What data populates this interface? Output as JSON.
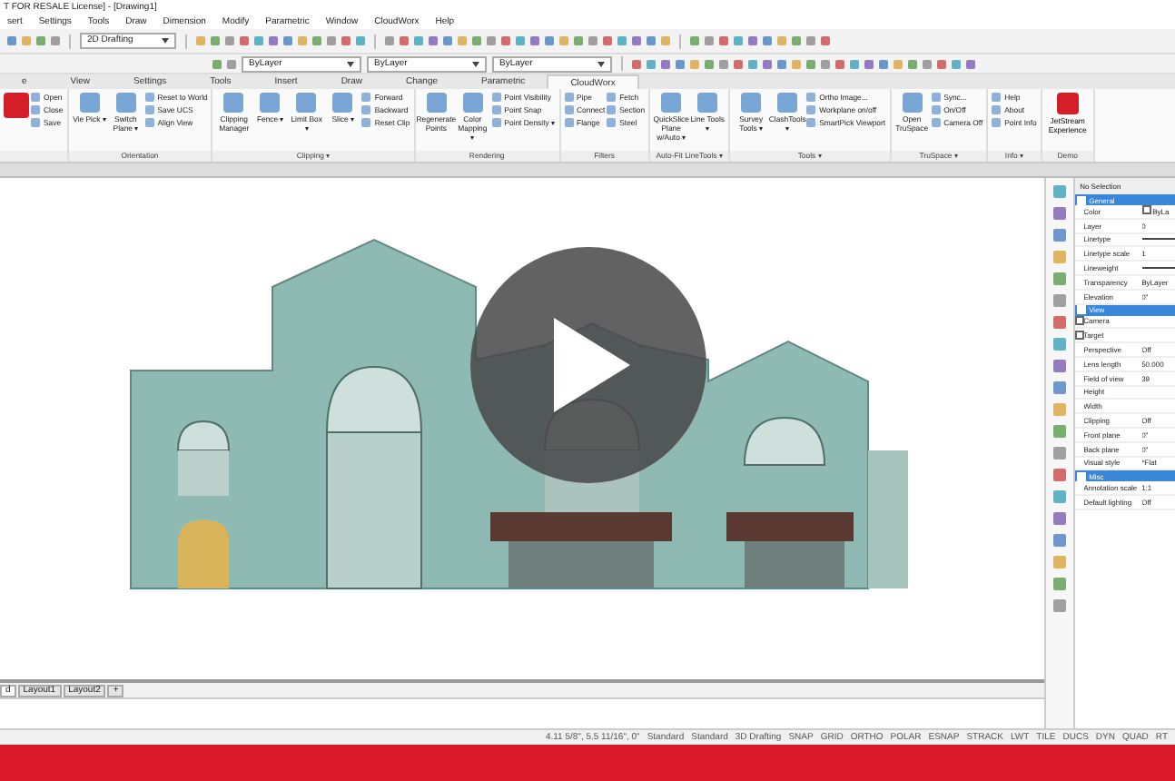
{
  "window": {
    "title": "T FOR RESALE License] - [Drawing1]"
  },
  "menu": [
    "sert",
    "Settings",
    "Tools",
    "Draw",
    "Dimension",
    "Modify",
    "Parametric",
    "Window",
    "CloudWorx",
    "Help"
  ],
  "toolbar": {
    "workspace": "2D Drafting",
    "layer_fields": [
      "ByLayer",
      "ByLayer",
      "ByLayer"
    ]
  },
  "ribbon_tabs": [
    {
      "label": "e",
      "selected": false
    },
    {
      "label": "View",
      "selected": false
    },
    {
      "label": "Settings",
      "selected": false
    },
    {
      "label": "Tools",
      "selected": false
    },
    {
      "label": "Insert",
      "selected": false
    },
    {
      "label": "Draw",
      "selected": false
    },
    {
      "label": "Change",
      "selected": false
    },
    {
      "label": "Parametric",
      "selected": false
    },
    {
      "label": "CloudWorx",
      "selected": true
    }
  ],
  "ribbon_groups": [
    {
      "buttons": [
        {
          "kind": "big"
        },
        {
          "kind": "small",
          "label": "Open"
        },
        {
          "kind": "small",
          "label": "Close"
        },
        {
          "kind": "small",
          "label": "Save"
        }
      ]
    },
    {
      "label": "Orientation",
      "buttons": [
        {
          "kind": "big",
          "label": "Vie Pick ▾"
        },
        {
          "kind": "big",
          "label": "Switch Plane ▾"
        },
        {
          "kind": "small",
          "label": "Reset to World"
        },
        {
          "kind": "small",
          "label": "Save UCS"
        },
        {
          "kind": "small",
          "label": "Align View"
        }
      ]
    },
    {
      "label": "Clipping ▾",
      "buttons": [
        {
          "kind": "big",
          "label": "Clipping Manager"
        },
        {
          "kind": "big",
          "label": "Fence ▾"
        },
        {
          "kind": "big",
          "label": "Limit Box ▾"
        },
        {
          "kind": "big",
          "label": "Slice ▾"
        },
        {
          "kind": "small",
          "label": "Forward"
        },
        {
          "kind": "small",
          "label": "Backward"
        },
        {
          "kind": "small",
          "label": "Reset Clip"
        }
      ]
    },
    {
      "label": "Rendering",
      "buttons": [
        {
          "kind": "big",
          "label": "Regenerate Points"
        },
        {
          "kind": "big",
          "label": "Color Mapping ▾"
        },
        {
          "kind": "small",
          "label": "Point Visibility"
        },
        {
          "kind": "small",
          "label": "Point Snap"
        },
        {
          "kind": "small",
          "label": "Point Density ▾"
        }
      ]
    },
    {
      "label": "Filters",
      "buttons": [
        {
          "kind": "small",
          "label": "Pipe"
        },
        {
          "kind": "small",
          "label": "Connect"
        },
        {
          "kind": "small",
          "label": "Flange"
        },
        {
          "kind": "small",
          "label": "Fetch"
        },
        {
          "kind": "small",
          "label": "Section"
        },
        {
          "kind": "small",
          "label": "Steel"
        }
      ]
    },
    {
      "label": "Auto-Fit LineTools ▾",
      "buttons": [
        {
          "kind": "big",
          "label": "QuickSlice Plane w/Auto ▾"
        },
        {
          "kind": "big",
          "label": "Line Tools ▾"
        }
      ]
    },
    {
      "label": "Tools ▾",
      "buttons": [
        {
          "kind": "big",
          "label": "Survey Tools ▾"
        },
        {
          "kind": "big",
          "label": "ClashTools ▾"
        },
        {
          "kind": "small",
          "label": "Ortho Image..."
        },
        {
          "kind": "small",
          "label": "Workplane on/off"
        },
        {
          "kind": "small",
          "label": "SmartPick Viewport"
        }
      ]
    },
    {
      "label": "TruSpace ▾",
      "buttons": [
        {
          "kind": "big",
          "label": "Open TruSpace"
        },
        {
          "kind": "small",
          "label": "Sync..."
        },
        {
          "kind": "small",
          "label": "On/Off"
        },
        {
          "kind": "small",
          "label": "Camera Off"
        }
      ]
    },
    {
      "label": "Info ▾",
      "buttons": [
        {
          "kind": "small",
          "label": "Help"
        },
        {
          "kind": "small",
          "label": "About"
        },
        {
          "kind": "small",
          "label": "Point Info"
        }
      ]
    },
    {
      "label": "Demo",
      "buttons": [
        {
          "kind": "demo",
          "label": "JetStream Experience"
        }
      ]
    }
  ],
  "properties": {
    "header": "No Selection",
    "sections": [
      {
        "title": "General",
        "expanded": true,
        "rows": [
          {
            "kind": "color",
            "label": "Color",
            "value": "ByLa"
          },
          {
            "kind": "row",
            "label": "Layer",
            "value": "0"
          },
          {
            "kind": "line",
            "label": "Linetype"
          },
          {
            "kind": "row",
            "label": "Linetype scale",
            "value": "1"
          },
          {
            "kind": "line",
            "label": "Lineweight"
          },
          {
            "kind": "row",
            "label": "Transparency",
            "value": "ByLayer"
          },
          {
            "kind": "row",
            "label": "Elevation",
            "value": "0\""
          }
        ]
      },
      {
        "title": "View",
        "expanded": true,
        "rows": [
          {
            "kind": "expander",
            "label": "Camera"
          },
          {
            "kind": "expander",
            "label": "Target"
          },
          {
            "kind": "row",
            "label": "Perspective",
            "value": "Off"
          },
          {
            "kind": "row",
            "label": "Lens length",
            "value": "50.000"
          },
          {
            "kind": "row",
            "label": "Field of view",
            "value": "39"
          },
          {
            "kind": "row",
            "label": "Height"
          },
          {
            "kind": "row",
            "label": "Width"
          },
          {
            "kind": "row",
            "label": "Clipping",
            "value": "Off"
          },
          {
            "kind": "row",
            "label": "Front plane",
            "value": "0\""
          },
          {
            "kind": "row",
            "label": "Back plane",
            "value": "0\""
          },
          {
            "kind": "row",
            "label": "Visual style",
            "value": "*Flat"
          }
        ]
      },
      {
        "title": "Misc",
        "expanded": true,
        "rows": [
          {
            "kind": "row",
            "label": "Annotation scale",
            "value": "1:1"
          },
          {
            "kind": "row",
            "label": "Default lighting",
            "value": "Off"
          }
        ]
      }
    ]
  },
  "layout_tabs": [
    {
      "label": "d",
      "selected": true
    },
    {
      "label": "Layout1",
      "selected": false
    },
    {
      "label": "Layout2",
      "selected": false
    },
    {
      "label": "+",
      "selected": false
    }
  ],
  "status_bar": [
    "4.11 5/8\", 5.5 11/16\", 0\"",
    "Standard",
    "Standard",
    "3D Drafting",
    "SNAP",
    "GRID",
    "ORTHO",
    "POLAR",
    "ESNAP",
    "STRACK",
    "LWT",
    "TILE",
    "DUCS",
    "DYN",
    "QUAD",
    "RT"
  ]
}
